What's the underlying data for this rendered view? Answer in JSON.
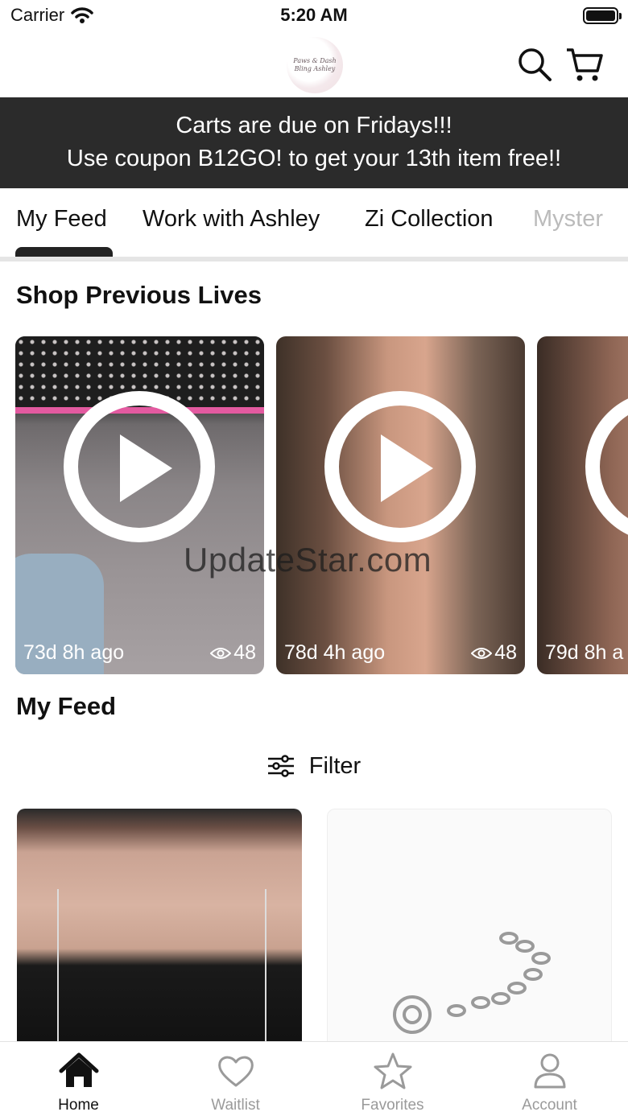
{
  "status_bar": {
    "carrier": "Carrier",
    "time": "5:20 AM"
  },
  "header": {
    "logo_text": "Paws & Dash Bling Ashley"
  },
  "promo": {
    "line1": "Carts are due on Fridays!!!",
    "line2": "Use coupon B12GO! to get your 13th item free!!"
  },
  "tabs": [
    {
      "label": "My Feed",
      "active": true
    },
    {
      "label": "Work with Ashley",
      "active": false
    },
    {
      "label": "Zi Collection",
      "active": false
    },
    {
      "label": "Myster",
      "active": false
    }
  ],
  "previous_lives": {
    "title": "Shop Previous Lives",
    "items": [
      {
        "ago": "73d 8h ago",
        "views": "48"
      },
      {
        "ago": "78d 4h ago",
        "views": "48"
      },
      {
        "ago": "79d 8h a",
        "views": ""
      }
    ]
  },
  "watermark": "UpdateStar.com",
  "feed": {
    "title": "My Feed",
    "filter_label": "Filter"
  },
  "bottom_nav": [
    {
      "label": "Home",
      "icon": "home-icon",
      "active": true
    },
    {
      "label": "Waitlist",
      "icon": "heart-icon",
      "active": false
    },
    {
      "label": "Favorites",
      "icon": "star-icon",
      "active": false
    },
    {
      "label": "Account",
      "icon": "person-icon",
      "active": false
    }
  ],
  "colors": {
    "promo_bg": "#2b2b2b",
    "active": "#111111",
    "inactive": "#9a9a9a"
  }
}
